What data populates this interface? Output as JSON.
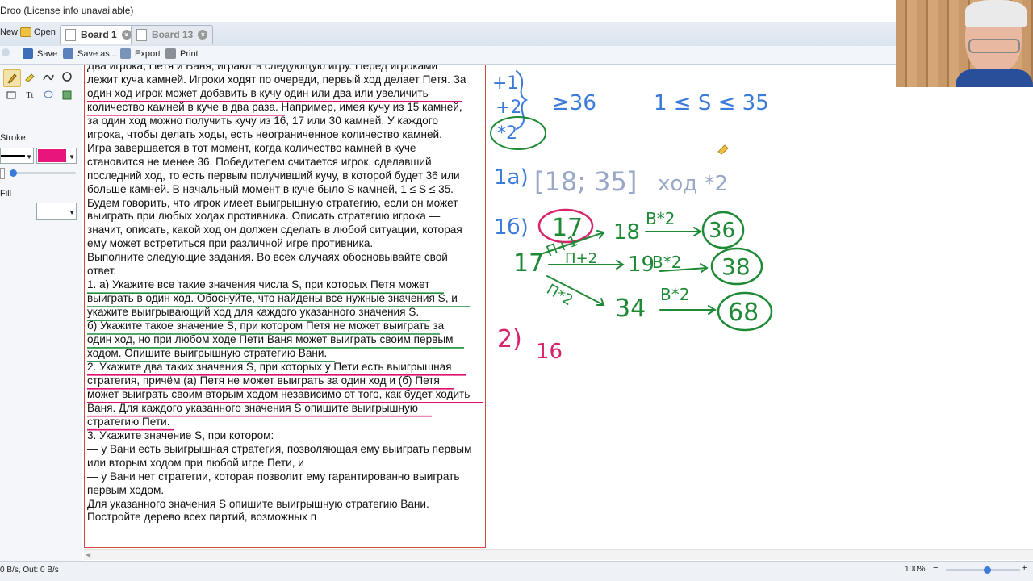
{
  "app": {
    "title": "Droo (License info unavailable)"
  },
  "tabbar": {
    "new_label": "New",
    "open_label": "Open",
    "tabs": [
      {
        "label": "Board 1",
        "active": true
      },
      {
        "label": "Board 13",
        "active": false
      }
    ]
  },
  "toolbar": {
    "save_label": "Save",
    "save_as_label": "Save as...",
    "export_label": "Export",
    "print_label": "Print"
  },
  "left_panel": {
    "stroke_label": "Stroke",
    "fill_label": "Fill",
    "stroke_color": "#e8157d"
  },
  "document": {
    "lines": [
      "Два игрока, Петя и Ваня, играют в следующую игру. Перед игроками",
      "лежит куча камней. Игроки ходят по очереди, первый ход делает Петя. За",
      "один ход игрок может добавить в кучу один или два или увеличить",
      "количество камней в куче в два раза. Например, имея кучу из 15 камней,",
      "за один ход можно получить кучу из 16, 17 или 30 камней. У каждого",
      "игрока, чтобы делать ходы, есть неограниченное количество камней.",
      "Игра завершается в тот момент, когда количество камней в куче",
      "становится не менее 36. Победителем считается игрок, сделавший",
      "последний ход, то есть первым получивший кучу, в которой будет 36 или",
      "больше камней. В начальный момент в куче было S камней, 1 ≤ S ≤ 35.",
      "Будем говорить, что игрок имеет выигрышную стратегию, если он может",
      "выиграть при любых ходах противника. Описать стратегию игрока —",
      "значит, описать, какой ход он должен сделать в любой ситуации, которая",
      "ему может встретиться при различной игре противника.",
      "Выполните следующие задания. Во всех случаях обосновывайте свой",
      "ответ.",
      "1. а) Укажите все такие значения числа S, при которых Петя может",
      "выиграть в один ход. Обоснуйте, что найдены все нужные значения S, и",
      "укажите выигрывающий ход для каждого указанного значения S.",
      "б) Укажите такое значение S, при котором Петя не может выиграть за",
      "один ход, но при любом ходе Пети Ваня может выиграть своим первым",
      "ходом. Опишите выигрышную стратегию Вани.",
      "2. Укажите два таких значения S, при которых у Пети есть выигрышная",
      "стратегия, причём (а) Петя не может выиграть за один ход и (б) Петя",
      "может выиграть своим вторым ходом независимо от того, как будет ходить",
      "Ваня. Для каждого указанного значения S опишите выигрышную",
      "стратегию Пети.",
      "3. Укажите значение S, при котором:",
      "— у Вани есть выигрышная стратегия, позволяющая ему выиграть первым",
      "или вторым ходом при любой игре Пети, и",
      "— у Вани нет стратегии, которая позволит ему гарантированно выиграть",
      "первым ходом.",
      "Для указанного значения S опишите выигрышную стратегию Вани.",
      "Постройте дерево всех партий, возможных п"
    ]
  },
  "board": {
    "moves": [
      "+1",
      "+2",
      "*2"
    ],
    "cond_win": "≥36",
    "range": "1 ≤ S ≤ 35",
    "ans_1a_label": "1a)",
    "ans_1a_interval": "[18; 35]",
    "ans_1a_move": "ход *2",
    "ans_1b_label": "1б)",
    "s17": "17",
    "n18": "18",
    "n19": "19",
    "n34": "34",
    "res36": "36",
    "res38": "38",
    "res68": "68",
    "edge_p1": "П+1",
    "edge_p2": "П+2",
    "edge_p3": "П*2",
    "edge_b1": "В*2",
    "edge_b2": "В*2",
    "edge_b3": "В*2",
    "ans_2_label": "2)",
    "ans_2_val": "16"
  },
  "status": {
    "net": "0 B/s, Out: 0 B/s",
    "zoom": "100%"
  },
  "colors": {
    "ink_blue": "#3a7ad8",
    "ink_green": "#1f8a36",
    "ink_magenta": "#d8246b",
    "underline_pink": "#e0116e",
    "underline_green": "#1d8c3e"
  }
}
